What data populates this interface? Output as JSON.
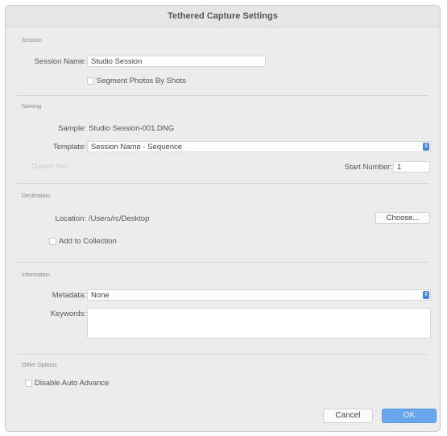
{
  "window": {
    "title": "Tethered Capture Settings"
  },
  "session": {
    "section_label": "Session",
    "name_label": "Session Name:",
    "name_value": "Studio Session",
    "segment_label": "Segment Photos By Shots"
  },
  "naming": {
    "section_label": "Naming",
    "sample_label": "Sample:",
    "sample_value": "Studio Session-001.DNG",
    "template_label": "Template:",
    "template_value": "Session Name - Sequence",
    "custom_text_label": "Custom Text:",
    "start_number_label": "Start Number:",
    "start_number_value": "1"
  },
  "destination": {
    "section_label": "Destination",
    "location_label": "Location:",
    "location_value": "/Users/rc/Desktop",
    "choose_label": "Choose...",
    "add_collection_label": "Add to Collection"
  },
  "information": {
    "section_label": "Information",
    "metadata_label": "Metadata:",
    "metadata_value": "None",
    "keywords_label": "Keywords:",
    "keywords_value": ""
  },
  "other": {
    "section_label": "Other Options",
    "disable_advance_label": "Disable Auto Advance"
  },
  "footer": {
    "cancel_label": "Cancel",
    "ok_label": "OK"
  },
  "icons": {
    "stepper": "up-down-stepper-icon",
    "stepper_color": "#4a86d8"
  }
}
